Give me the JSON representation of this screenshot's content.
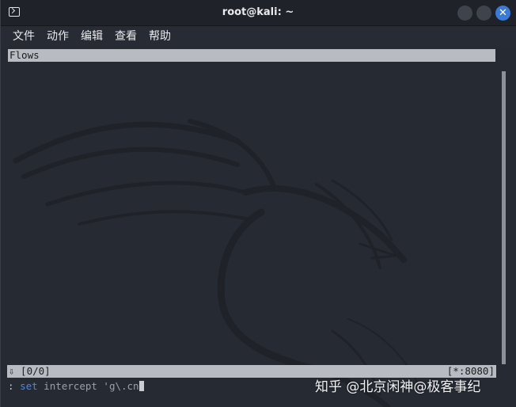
{
  "window": {
    "title": "root@kali: ~",
    "close_glyph": "✕"
  },
  "menu": {
    "items": [
      {
        "label": "文件"
      },
      {
        "label": "动作"
      },
      {
        "label": "编辑"
      },
      {
        "label": "查看"
      },
      {
        "label": "帮助"
      }
    ]
  },
  "terminal": {
    "flows_header": "Flows",
    "status": {
      "left": "⇩  [0/0]",
      "right": "[*:8080]"
    },
    "command": {
      "prompt": ": ",
      "keyword": "set",
      "args": " intercept 'g\\.cn"
    }
  },
  "watermark": {
    "text": "知乎 @北京闲神@极客事纪"
  },
  "colors": {
    "titlebar_bg": "#1f2228",
    "terminal_bg": "#262a32",
    "bar_bg": "#b8bcc2",
    "keyword": "#4f86e0",
    "close_button": "#3b7bd8"
  },
  "icons": {
    "app_icon": "terminal-icon",
    "close": "close-icon",
    "minimize": "minimize-icon",
    "maximize": "maximize-icon",
    "status_arrow": "down-arrow-icon"
  }
}
